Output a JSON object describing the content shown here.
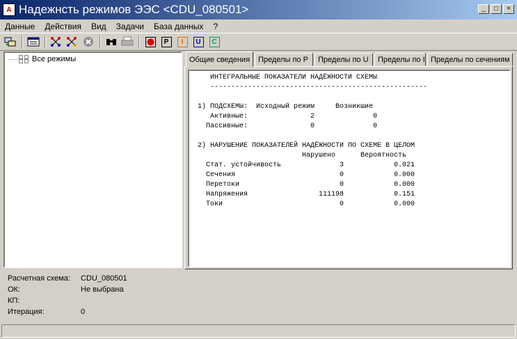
{
  "window": {
    "title": "Надежнсть режимов ЭЭС <CDU_080501>",
    "icon_letter": "A",
    "minimize_symbol": "_",
    "maximize_symbol": "□",
    "close_symbol": "×"
  },
  "menu": [
    "Данные",
    "Действия",
    "Вид",
    "Задачи",
    "База данных",
    "?"
  ],
  "toolbar": {
    "buttons": [
      {
        "icon": "connect-icon"
      },
      {
        "icon": "table-icon"
      },
      {
        "icon": "network-add-icon"
      },
      {
        "icon": "network-remove-icon"
      },
      {
        "icon": "stop-circle-icon"
      },
      {
        "icon": "binoculars-icon"
      },
      {
        "icon": "printer-icon"
      },
      {
        "icon": "record-icon"
      },
      {
        "icon": "p-mode-icon",
        "letter": "P"
      },
      {
        "icon": "i-mode-icon",
        "letter": "I"
      },
      {
        "icon": "u-mode-icon",
        "letter": "U"
      },
      {
        "icon": "c-mode-icon",
        "letter": "C"
      }
    ],
    "colors": {
      "record": "#e00000",
      "p": "#000000",
      "i": "#e07000",
      "u": "#0000c0",
      "c": "#00a060"
    }
  },
  "tree": {
    "root_label": "Все режимы"
  },
  "tabs": [
    "Общие сведения",
    "Пределы по P",
    "Пределы по U",
    "Пределы по I",
    "Пределы по сечениям"
  ],
  "report": {
    "lines": [
      "     ИНТЕГРАЛЬНЫЕ ПОКАЗАТЕЛИ НАДЁЖНОСТИ СХЕМЫ",
      "     ----------------------------------------------------",
      "",
      "  1) ПОДСХЕМЫ:  Исходный режим     Возникшие",
      "     Активные:               2              0",
      "    Пассивные:               0              0",
      "",
      "  2) НАРУШЕНИЕ ПОКАЗАТЕЛЕЙ НАДЁЖНОСТИ ПО СХЕМЕ В ЦЕЛОМ",
      "                           Нарушено      Вероятность",
      "    Стат. устойчивость              3            0.021",
      "    Сечения                         0            0.000",
      "    Перетоки                        0            0.000",
      "    Напряжения                 111198            0.151",
      "    Токи                            0            0.000"
    ]
  },
  "info": [
    {
      "label": "Расчетная схема:",
      "value": "CDU_080501"
    },
    {
      "label": "ОК:",
      "value": "Не выбрана"
    },
    {
      "label": "КП:",
      "value": ""
    },
    {
      "label": "Итерация:",
      "value": "0"
    }
  ]
}
